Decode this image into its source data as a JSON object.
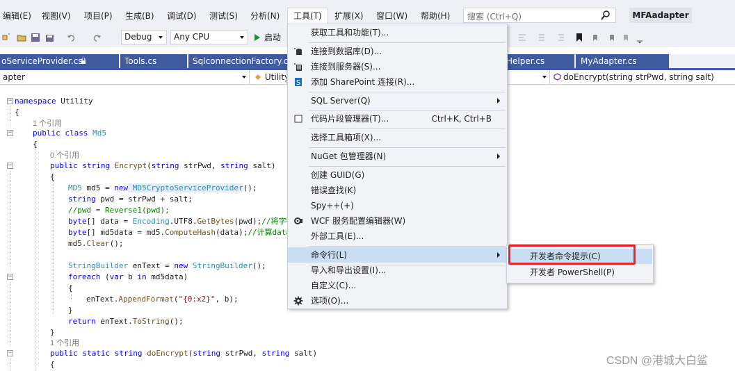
{
  "menubar": {
    "items": [
      "编辑(E)",
      "视图(V)",
      "项目(P)",
      "生成(B)",
      "调试(D)",
      "测试(S)",
      "分析(N)",
      "工具(T)",
      "扩展(X)",
      "窗口(W)",
      "帮助(H)"
    ],
    "search_placeholder": "搜索 (Ctrl+Q)",
    "project_title": "MFAadapter"
  },
  "toolbar": {
    "config": "Debug",
    "platform": "Any CPU",
    "start_label": "启动"
  },
  "tabs": [
    "oServiceProvider.cs",
    "Tools.cs",
    "SqlconnectionFactory.cs",
    "Helper.cs",
    "MyAdapter.cs"
  ],
  "navbar": {
    "project": "apter",
    "class": "Utility",
    "member": "doEncrypt(string strPwd, string salt)"
  },
  "code": {
    "l1_kw": "namespace",
    "l1_rest": " Utility",
    "l2": "{",
    "ref1": "1 个引用",
    "l3_kw": "public class",
    "l3_ty": " Md5",
    "l4": "{",
    "ref0": "0 个引用",
    "l5_kw": "public string",
    "l5_m": " Encrypt",
    "l5_a": "(",
    "l5_k2": "string",
    "l5_b": " strPwd, ",
    "l5_k3": "string",
    "l5_c": " salt)",
    "l6": "{",
    "l7_ty": "MD5",
    "l7_a": " md5 = ",
    "l7_kw": "new",
    "l7_ty2": " MD5CryptoServiceProvider",
    "l7_b": "();",
    "l8_kw": "string",
    "l8_a": " pwd = strPwd + salt;",
    "l9_cm": "//pwd = Reverse1(pwd);",
    "l10_kw": "byte",
    "l10_a": "[] data = ",
    "l10_ty": "Encoding",
    "l10_b": ".UTF8.",
    "l10_m": "GetBytes",
    "l10_c": "(pwd);",
    "l10_cm": "//将字符",
    "l11_kw": "byte",
    "l11_a": "[] md5data = md5.",
    "l11_m": "ComputeHash",
    "l11_b": "(data);",
    "l11_cm": "//计算data",
    "l12_a": "md5.",
    "l12_m": "Clear",
    "l12_b": "();",
    "l13_ty": "StringBuilder",
    "l13_a": " enText = ",
    "l13_kw": "new",
    "l13_ty2": " StringBuilder",
    "l13_b": "();",
    "l14_kw": "foreach",
    "l14_a": " (",
    "l14_kw2": "var",
    "l14_b": " b ",
    "l14_kw3": "in",
    "l14_c": " md5data)",
    "l15": "{",
    "l16_a": "enText.",
    "l16_m": "AppendFormat",
    "l16_b": "(",
    "l16_st": "\"{0:x2}\"",
    "l16_c": ", b);",
    "l17": "}",
    "l18_kw": "return",
    "l18_a": " enText.",
    "l18_m": "ToString",
    "l18_b": "();",
    "l19": "}",
    "ref1b": "1 个引用",
    "l20_kw": "public static string",
    "l20_m": " doEncrypt",
    "l20_a": "(",
    "l20_k2": "string",
    "l20_b": " strPwd, ",
    "l20_k3": "string",
    "l20_c": " salt)",
    "l21": "{"
  },
  "tools_menu": {
    "items": [
      {
        "label": "获取工具和功能(T)...",
        "icon": "none"
      },
      {
        "label": "连接到数据库(D)...",
        "icon": "database-connect-icon"
      },
      {
        "label": "连接到服务器(S)...",
        "icon": "server-connect-icon"
      },
      {
        "label": "添加 SharePoint 连接(R)...",
        "icon": "sharepoint-icon"
      },
      {
        "label": "SQL Server(Q)",
        "icon": "none",
        "submenu": true
      },
      {
        "label": "代码片段管理器(T)...",
        "icon": "snippet-icon",
        "shortcut": "Ctrl+K, Ctrl+B"
      },
      {
        "label": "选择工具箱项(X)...",
        "icon": "none"
      },
      {
        "label": "NuGet 包管理器(N)",
        "icon": "none",
        "submenu": true
      },
      {
        "label": "创建 GUID(G)",
        "icon": "none"
      },
      {
        "label": "错误查找(K)",
        "icon": "none"
      },
      {
        "label": "Spy++(+)",
        "icon": "none"
      },
      {
        "label": "WCF 服务配置编辑器(W)",
        "icon": "wcf-config-icon"
      },
      {
        "label": "外部工具(E)...",
        "icon": "none"
      },
      {
        "label": "命令行(L)",
        "icon": "none",
        "submenu": true,
        "highlighted": true
      },
      {
        "label": "导入和导出设置(I)...",
        "icon": "none"
      },
      {
        "label": "自定义(C)...",
        "icon": "none"
      },
      {
        "label": "选项(O)...",
        "icon": "gear-icon"
      }
    ]
  },
  "command_submenu": {
    "items": [
      "开发者命令提示(C)",
      "开发者 PowerShell(P)"
    ]
  },
  "watermark": "CSDN @港城大白鲨",
  "colors": {
    "menu_bg": "#eef0f5",
    "tab_active": "#3f5a9e",
    "highlight": "#c9def5",
    "annotation_red": "#e8262a"
  }
}
